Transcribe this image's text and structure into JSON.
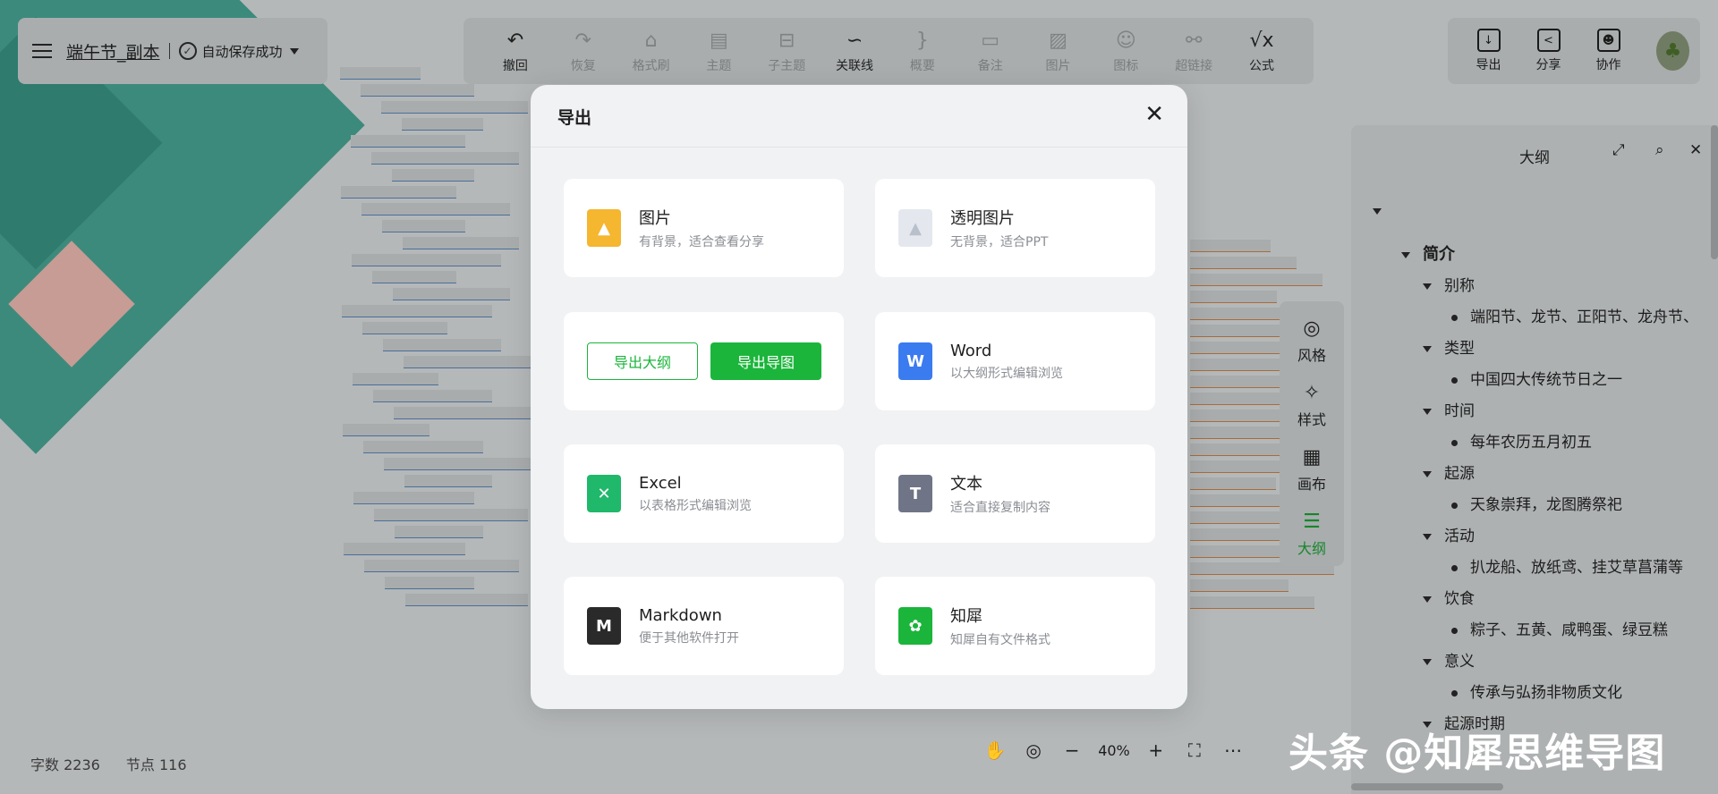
{
  "file": {
    "name": "端午节_副本",
    "save_status": "自动保存成功"
  },
  "toolbar": [
    {
      "label": "撤回",
      "icon": "undo-icon",
      "glyph": "↶",
      "active": true
    },
    {
      "label": "恢复",
      "icon": "redo-icon",
      "glyph": "↷",
      "active": false
    },
    {
      "label": "格式刷",
      "icon": "format-brush-icon",
      "glyph": "⌂",
      "active": false
    },
    {
      "label": "主题",
      "icon": "topic-icon",
      "glyph": "▤",
      "active": false
    },
    {
      "label": "子主题",
      "icon": "subtopic-icon",
      "glyph": "⊟",
      "active": false
    },
    {
      "label": "关联线",
      "icon": "relation-line-icon",
      "glyph": "∽",
      "active": true
    },
    {
      "label": "概要",
      "icon": "summary-icon",
      "glyph": "}",
      "active": false
    },
    {
      "label": "备注",
      "icon": "note-icon",
      "glyph": "▭",
      "active": false
    },
    {
      "label": "图片",
      "icon": "image-icon",
      "glyph": "▨",
      "active": false
    },
    {
      "label": "图标",
      "icon": "emoji-icon",
      "glyph": "☺",
      "active": false
    },
    {
      "label": "超链接",
      "icon": "link-icon",
      "glyph": "⚯",
      "active": false
    },
    {
      "label": "公式",
      "icon": "formula-icon",
      "glyph": "√x",
      "active": true
    }
  ],
  "right_tools": [
    {
      "label": "导出",
      "icon": "export-icon",
      "glyph": "↓"
    },
    {
      "label": "分享",
      "icon": "share-icon",
      "glyph": "<"
    },
    {
      "label": "协作",
      "icon": "collaborate-icon",
      "glyph": "☻"
    }
  ],
  "outline": {
    "title": "大纲",
    "rows": [
      {
        "level": 0,
        "type": "caret",
        "text": "简介"
      },
      {
        "level": 1,
        "type": "caret",
        "text": "别称"
      },
      {
        "level": 2,
        "type": "dot",
        "text": "端阳节、龙节、正阳节、龙舟节、"
      },
      {
        "level": 1,
        "type": "caret",
        "text": "类型"
      },
      {
        "level": 2,
        "type": "dot",
        "text": "中国四大传统节日之一"
      },
      {
        "level": 1,
        "type": "caret",
        "text": "时间"
      },
      {
        "level": 2,
        "type": "dot",
        "text": "每年农历五月初五"
      },
      {
        "level": 1,
        "type": "caret",
        "text": "起源"
      },
      {
        "level": 2,
        "type": "dot",
        "text": "天象崇拜，龙图腾祭祀"
      },
      {
        "level": 1,
        "type": "caret",
        "text": "活动"
      },
      {
        "level": 2,
        "type": "dot",
        "text": "扒龙船、放纸鸢、挂艾草菖蒲等"
      },
      {
        "level": 1,
        "type": "caret",
        "text": "饮食"
      },
      {
        "level": 2,
        "type": "dot",
        "text": "粽子、五黄、咸鸭蛋、绿豆糕"
      },
      {
        "level": 1,
        "type": "caret",
        "text": "意义"
      },
      {
        "level": 2,
        "type": "dot",
        "text": "传承与弘扬非物质文化"
      },
      {
        "level": 1,
        "type": "caret",
        "text": "起源时期"
      }
    ]
  },
  "side": [
    {
      "label": "风格",
      "icon": "palette-icon",
      "glyph": "◎",
      "active": false
    },
    {
      "label": "样式",
      "icon": "style-icon",
      "glyph": "✧",
      "active": false
    },
    {
      "label": "画布",
      "icon": "canvas-icon",
      "glyph": "▦",
      "active": false
    },
    {
      "label": "大纲",
      "icon": "outline-icon",
      "glyph": "☰",
      "active": true
    }
  ],
  "stats": {
    "words": "字数 2236",
    "nodes": "节点 116"
  },
  "zoom": {
    "value": "40%"
  },
  "watermark": "头条 @知犀思维导图",
  "modal": {
    "title": "导出",
    "cards": [
      {
        "title": "图片",
        "subtitle": "有背景，适合查看分享",
        "icon": "image-export-icon",
        "color": "#f5b630",
        "glyph": "▲"
      },
      {
        "title": "透明图片",
        "subtitle": "无背景，适合PPT",
        "icon": "transparent-image-icon",
        "color": "#e4e8ee",
        "glyph": "▲"
      },
      {
        "title": "Word",
        "subtitle": "以大纲形式编辑浏览",
        "icon": "word-icon",
        "color": "#3b7bf0",
        "glyph": "W"
      },
      {
        "title": "Excel",
        "subtitle": "以表格形式编辑浏览",
        "icon": "excel-icon",
        "color": "#20b86b",
        "glyph": "✕"
      },
      {
        "title": "文本",
        "subtitle": "适合直接复制内容",
        "icon": "text-icon",
        "color": "#6f7586",
        "glyph": "T"
      },
      {
        "title": "Markdown",
        "subtitle": "便于其他软件打开",
        "icon": "markdown-icon",
        "color": "#2a2a2a",
        "glyph": "M"
      },
      {
        "title": "知犀",
        "subtitle": "知犀自有文件格式",
        "icon": "zhixi-icon",
        "color": "#1bb53b",
        "glyph": "✿"
      }
    ],
    "export_outline_label": "导出大纲",
    "export_map_label": "导出导图"
  }
}
